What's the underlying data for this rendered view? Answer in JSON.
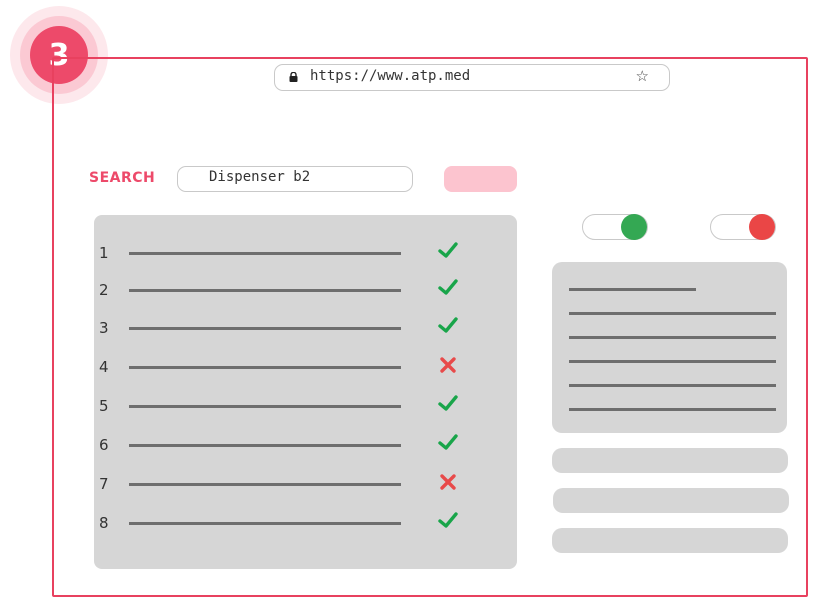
{
  "step": {
    "number": "3"
  },
  "browser": {
    "url": "https://www.atp.med",
    "icons": [
      "lock-icon",
      "star-icon"
    ]
  },
  "search": {
    "label": "SEARCH",
    "value": "Dispenser b2"
  },
  "list": {
    "rows": [
      {
        "number": "1",
        "status": "ok"
      },
      {
        "number": "2",
        "status": "ok"
      },
      {
        "number": "3",
        "status": "ok"
      },
      {
        "number": "4",
        "status": "fail"
      },
      {
        "number": "5",
        "status": "ok"
      },
      {
        "number": "6",
        "status": "ok"
      },
      {
        "number": "7",
        "status": "fail"
      },
      {
        "number": "8",
        "status": "ok"
      }
    ]
  },
  "toggles": [
    {
      "state": "on",
      "color": "#34a853"
    },
    {
      "state": "on",
      "color": "#ea4646"
    }
  ],
  "colors": {
    "accent": "#ed4a6a",
    "frame": "#e8415f",
    "ok": "#19a54a",
    "fail": "#e84a4a",
    "panel": "#d6d6d6"
  }
}
